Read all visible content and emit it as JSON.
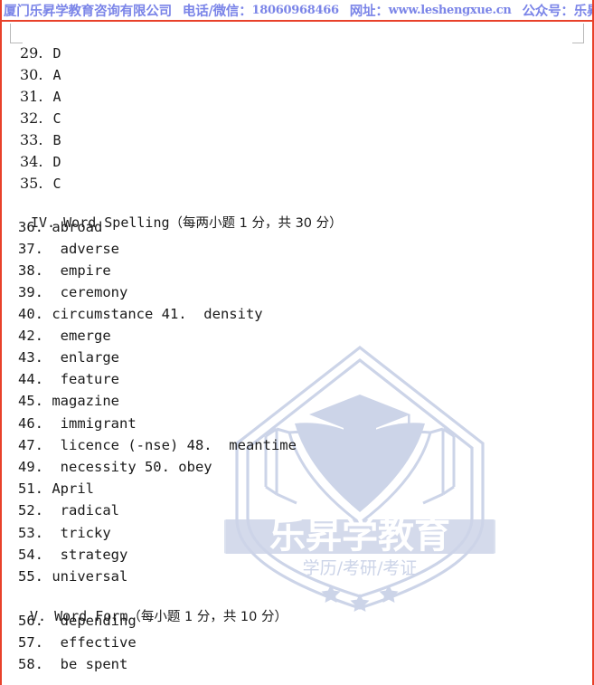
{
  "header": {
    "company": "厦门乐昇学教育咨询有限公司",
    "phone_label": "电话/微信：",
    "phone": "18060968466",
    "website_label": "网址：",
    "website": "www.leshengxue.cn",
    "wechat_label": "公众号：",
    "wechat": "乐昇学",
    "color": "#7b85e8",
    "rule_color": "#e8412a"
  },
  "watermark": {
    "banner_text": "乐昇学教育",
    "subtitle": "学历/考研/考证",
    "stars": 3,
    "color": "#ccd4e8"
  },
  "answers": {
    "items": [
      {
        "num": "29.",
        "value": "D"
      },
      {
        "num": "30.",
        "value": "A"
      },
      {
        "num": "31.",
        "value": "A"
      },
      {
        "num": "32.",
        "value": "C"
      },
      {
        "num": "33.",
        "value": "B"
      },
      {
        "num": "34.",
        "value": "D"
      },
      {
        "num": "35.",
        "value": "C"
      }
    ]
  },
  "section_word_spelling": {
    "roman": "IV.",
    "title": "Word Spelling",
    "scoring": "（每两小题 1 分，共 30 分）",
    "full": "IV. Word Spelling（每两小题 1 分，共 30 分）"
  },
  "spelling": {
    "lines": [
      {
        "text": "36. abroad"
      },
      {
        "text": "37.  adverse"
      },
      {
        "text": "38.  empire"
      },
      {
        "text": "39.  ceremony"
      },
      {
        "text": "40. circumstance 41.  density"
      },
      {
        "text": "42.  emerge"
      },
      {
        "text": "43.  enlarge"
      },
      {
        "text": "44.  feature"
      },
      {
        "text": "45. magazine"
      },
      {
        "text": "46.  immigrant"
      },
      {
        "text": "47.  licence (-nse) 48.  meantime"
      },
      {
        "text": "49.  necessity 50. obey"
      },
      {
        "text": "51. April"
      },
      {
        "text": "52.  radical"
      },
      {
        "text": "53.  tricky"
      },
      {
        "text": "54.  strategy"
      },
      {
        "text": "55. universal"
      }
    ]
  },
  "section_word_form": {
    "roman": "V.",
    "title": "Word Form",
    "scoring": "（每小题 1 分，共 10 分）",
    "full": "V. Word Form（每小题 1 分，共 10 分）"
  },
  "word_form": {
    "lines": [
      {
        "text": "56.  depending"
      },
      {
        "text": "57.  effective"
      },
      {
        "text": "58.  be spent"
      }
    ]
  }
}
